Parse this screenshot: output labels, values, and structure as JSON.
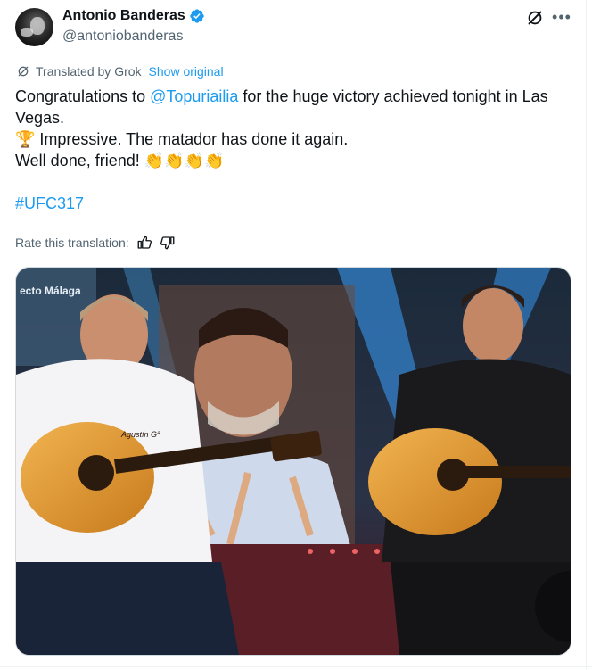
{
  "tweet": {
    "author": {
      "display_name": "Antonio Banderas",
      "handle": "@antoniobanderas",
      "verified": true,
      "verified_color": "#1d9bf0"
    },
    "translation_notice": {
      "text": "Translated by Grok",
      "link": "Show original"
    },
    "body": {
      "line1_pre": "Congratulations to ",
      "mention": "@Topuriailia",
      "line1_post": " for the huge victory achieved tonight in Las Vegas.",
      "line2_emoji": "🏆",
      "line2_text": " Impressive. The matador has done it again.",
      "line3_text": "Well done, friend! ",
      "claps": [
        "👏",
        "👏",
        "👏",
        "👏"
      ],
      "hashtag": "#UFC317"
    },
    "rate_translation": {
      "label": "Rate this translation:"
    },
    "media": {
      "screen_sign": "ecto Málaga",
      "guitar_label": "Agustín Gª"
    },
    "colors": {
      "link": "#1d9bf0",
      "secondary_text": "#536471"
    },
    "icons": [
      "verified-icon",
      "grok-icon",
      "more-icon",
      "translate-icon",
      "thumbs-up-icon",
      "thumbs-down-icon"
    ]
  }
}
